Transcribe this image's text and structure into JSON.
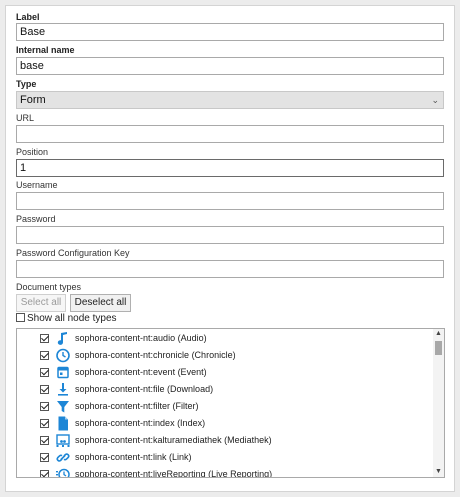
{
  "form": {
    "label": {
      "label": "Label",
      "value": "Base"
    },
    "internal_name": {
      "label": "Internal name",
      "value": "base"
    },
    "type": {
      "label": "Type",
      "value": "Form"
    },
    "url": {
      "label": "URL",
      "value": ""
    },
    "position": {
      "label": "Position",
      "value": "1"
    },
    "username": {
      "label": "Username",
      "value": ""
    },
    "password": {
      "label": "Password",
      "value": ""
    },
    "password_config_key": {
      "label": "Password Configuration Key",
      "value": ""
    }
  },
  "document_types": {
    "label": "Document types",
    "select_all": "Select all",
    "deselect_all": "Deselect all",
    "show_all_label": "Show all node types",
    "show_all_checked": false,
    "items": [
      {
        "label": "sophora-content-nt:audio (Audio)",
        "icon": "music-note-icon",
        "checked": true
      },
      {
        "label": "sophora-content-nt:chronicle (Chronicle)",
        "icon": "clock-icon",
        "checked": true
      },
      {
        "label": "sophora-content-nt:event (Event)",
        "icon": "calendar-icon",
        "checked": true
      },
      {
        "label": "sophora-content-nt:file (Download)",
        "icon": "download-icon",
        "checked": true
      },
      {
        "label": "sophora-content-nt:filter (Filter)",
        "icon": "filter-icon",
        "checked": true
      },
      {
        "label": "sophora-content-nt:index (Index)",
        "icon": "document-icon",
        "checked": true
      },
      {
        "label": "sophora-content-nt:kalturamediathek (Mediathek)",
        "icon": "media-library-icon",
        "checked": true
      },
      {
        "label": "sophora-content-nt:link (Link)",
        "icon": "link-icon",
        "checked": true
      },
      {
        "label": "sophora-content-nt:liveReporting (Live Reporting)",
        "icon": "live-reporting-icon",
        "checked": true
      }
    ]
  },
  "colors": {
    "icon_blue": "#1d86d6"
  }
}
